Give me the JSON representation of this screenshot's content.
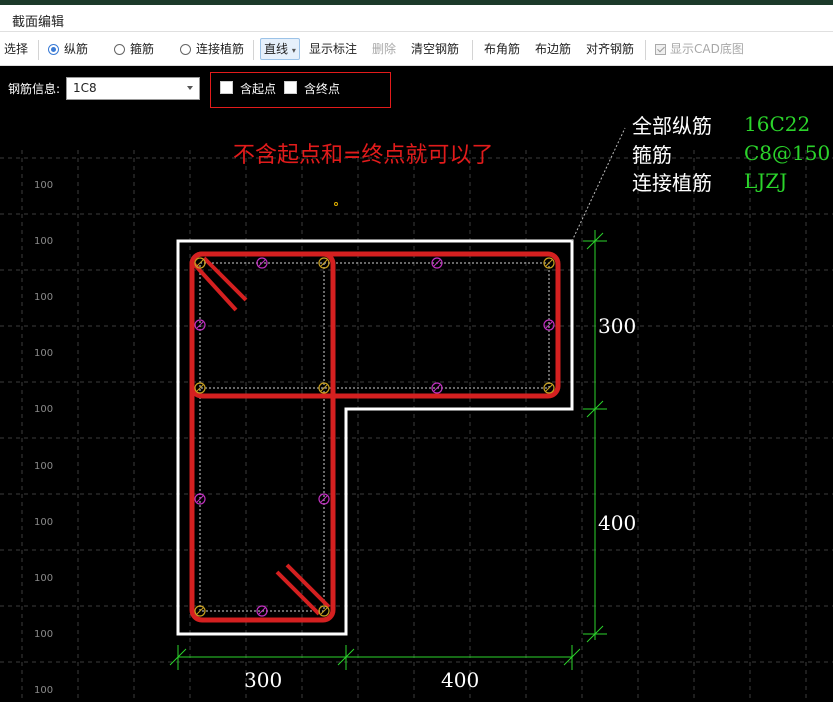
{
  "window": {
    "title": "截面编辑"
  },
  "toolbar": {
    "select": "选择",
    "rebar_types": [
      {
        "label": "纵筋",
        "selected": true
      },
      {
        "label": "箍筋",
        "selected": false
      },
      {
        "label": "连接植筋",
        "selected": false
      }
    ],
    "draw_mode": "直线",
    "show_labels": "显示标注",
    "delete": "删除",
    "clear": "清空钢筋",
    "corner": "布角筋",
    "edge": "布边筋",
    "align": "对齐钢筋",
    "show_cad": "显示CAD底图"
  },
  "options": {
    "rebar_info_label": "钢筋信息:",
    "rebar_info_value": "1C8",
    "include_start": "含起点",
    "include_end": "含终点"
  },
  "annotation": "不含起点和=终点就可以了",
  "rebar_summary": [
    {
      "key": "全部纵筋",
      "value": "16C22"
    },
    {
      "key": "箍筋",
      "value": "C8@150"
    },
    {
      "key": "连接植筋",
      "value": "LJZJ"
    }
  ],
  "dimensions": {
    "bottom_left": "300",
    "bottom_right": "400",
    "right_top": "300",
    "right_bottom": "400"
  },
  "grid_label": "100",
  "colors": {
    "stirrup": "#d42020",
    "outline": "#ffffff",
    "dimension": "#2bd42b",
    "note": "#e21b1b",
    "bar_yellow": "#c8a020",
    "bar_magenta": "#c030c0"
  }
}
